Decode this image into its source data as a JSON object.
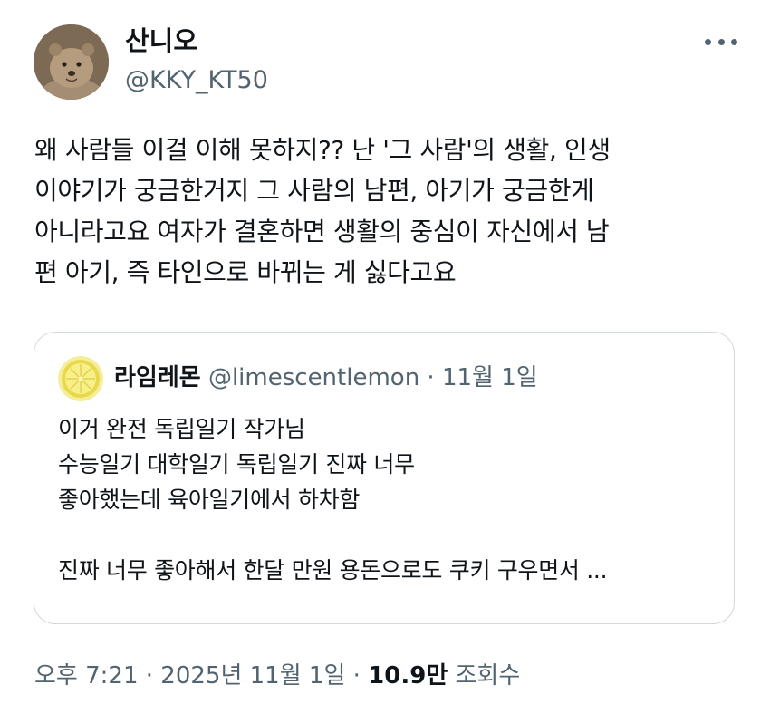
{
  "author": {
    "display_name": "산니오",
    "handle": "@KKY_KT50",
    "avatar_icon": "quokka-avatar-icon"
  },
  "more_icon": "more-dots-icon",
  "tweet": {
    "lines": [
      "왜 사람들 이걸 이해 못하지?? 난 '그 사람'의 생활, 인생",
      "이야기가 궁금한거지 그 사람의 남편, 아기가 궁금한게",
      "아니라고요 여자가 결혼하면 생활의 중심이 자신에서 남",
      "편 아기, 즉 타인으로 바뀌는 게 싫다고요"
    ]
  },
  "quoted": {
    "display_name": "라임레몬",
    "handle": "@limescentlemon",
    "separator": " · ",
    "date": "11월 1일",
    "avatar_icon": "lemon-avatar-icon",
    "lines": [
      "이거 완전 독립일기 작가님",
      "수능일기 대학일기 독립일기 진짜 너무",
      "좋아했는데 육아일기에서 하차함",
      "",
      "진짜 너무 좋아해서 한달 만원 용돈으로도 쿠키 구우면서 ..."
    ]
  },
  "footer": {
    "timestamp": "오후 7:21 · 2025년 11월 1일 · ",
    "views_count": "10.9만",
    "views_label": " 조회수"
  },
  "colors": {
    "text_primary": "#0f1419",
    "text_secondary": "#536471",
    "border": "#cfd9de"
  }
}
